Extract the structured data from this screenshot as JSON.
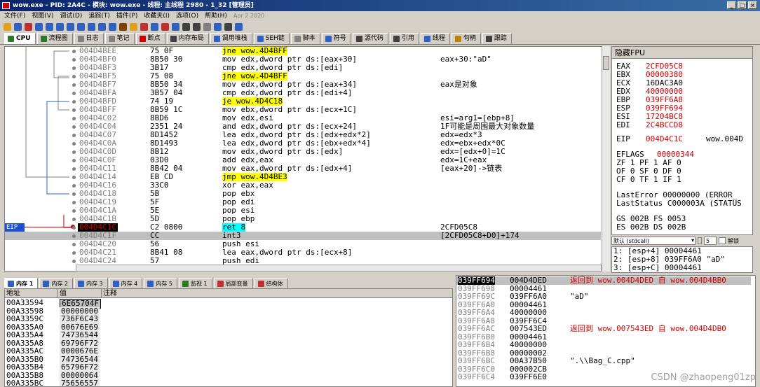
{
  "window": {
    "title": "wow.exe - PID: 2A4C - 模块: wow.exe - 线程: 主线程 2980 - 1_32 [管理员]"
  },
  "menu": {
    "items": [
      "文件(F)",
      "视图(V)",
      "调试(D)",
      "追踪(T)",
      "插件(P)",
      "收藏夹(I)",
      "选项(O)",
      "帮助(H)"
    ],
    "date": "Apr 2 2020"
  },
  "tabs": [
    {
      "label": "CPU",
      "color": "#2a7a2a"
    },
    {
      "label": "流程图",
      "color": "#2a7a2a"
    },
    {
      "label": "日志",
      "color": "#808080"
    },
    {
      "label": "笔记",
      "color": "#808080"
    },
    {
      "label": "断点",
      "color": "#cc0000"
    },
    {
      "label": "内存布局",
      "color": "#404040"
    },
    {
      "label": "调用堆栈",
      "color": "#3060c0"
    },
    {
      "label": "SEH链",
      "color": "#3060c0"
    },
    {
      "label": "脚本",
      "color": "#808080"
    },
    {
      "label": "符号",
      "color": "#3060c0"
    },
    {
      "label": "源代码",
      "color": "#404040"
    },
    {
      "label": "引用",
      "color": "#404040"
    },
    {
      "label": "线程",
      "color": "#3060c0"
    },
    {
      "label": "句柄",
      "color": "#c08000"
    },
    {
      "label": "跟踪",
      "color": "#404040"
    }
  ],
  "disasm": [
    {
      "addr": "004D4BEE",
      "bytes": "75 0F",
      "instr": "jne wow.4D4BFF",
      "cmt": "",
      "jmp": true
    },
    {
      "addr": "004D4BF0",
      "bytes": "8B50 30",
      "instr": "mov edx,dword ptr ds:[eax+30]",
      "cmt": "eax+30:\"aD\""
    },
    {
      "addr": "004D4BF3",
      "bytes": "3B17",
      "instr": "cmp edx,dword ptr ds:[edi]",
      "cmt": ""
    },
    {
      "addr": "004D4BF5",
      "bytes": "75 08",
      "instr": "jne wow.4D4BFF",
      "cmt": "",
      "jmp": true
    },
    {
      "addr": "004D4BF7",
      "bytes": "8B50 34",
      "instr": "mov edx,dword ptr ds:[eax+34]",
      "cmt": "eax是对象"
    },
    {
      "addr": "004D4BFA",
      "bytes": "3B57 04",
      "instr": "cmp edx,dword ptr ds:[edi+4]",
      "cmt": ""
    },
    {
      "addr": "004D4BFD",
      "bytes": "74 19",
      "instr": "je wow.4D4C18",
      "cmt": "",
      "jmp": true
    },
    {
      "addr": "004D4BFF",
      "bytes": "8B59 1C",
      "instr": "mov ebx,dword ptr ds:[ecx+1C]",
      "cmt": ""
    },
    {
      "addr": "004D4C02",
      "bytes": "8BD6",
      "instr": "mov edx,esi",
      "cmt": "esi=arg1=[ebp+8]"
    },
    {
      "addr": "004D4C04",
      "bytes": "2351 24",
      "instr": "and edx,dword ptr ds:[ecx+24]",
      "cmt": "1F可能是周围最大对象数量"
    },
    {
      "addr": "004D4C07",
      "bytes": "8D1452",
      "instr": "lea edx,dword ptr ds:[edx+edx*2]",
      "cmt": "edx=edx*3"
    },
    {
      "addr": "004D4C0A",
      "bytes": "8D1493",
      "instr": "lea edx,dword ptr ds:[ebx+edx*4]",
      "cmt": "edx=ebx+edx*0C"
    },
    {
      "addr": "004D4C0D",
      "bytes": "8B12",
      "instr": "mov edx,dword ptr ds:[edx]",
      "cmt": "edx=[edx+0]=1C"
    },
    {
      "addr": "004D4C0F",
      "bytes": "03D0",
      "instr": "add edx,eax",
      "cmt": "edx=1C+eax"
    },
    {
      "addr": "004D4C11",
      "bytes": "8B42 04",
      "instr": "mov eax,dword ptr ds:[edx+4]",
      "cmt": "[eax+20]->链表"
    },
    {
      "addr": "004D4C14",
      "bytes": "EB CD",
      "instr": "jmp wow.4D4BE3",
      "cmt": "",
      "jmp": true
    },
    {
      "addr": "004D4C16",
      "bytes": "33C0",
      "instr": "xor eax,eax",
      "cmt": ""
    },
    {
      "addr": "004D4C18",
      "bytes": "5B",
      "instr": "pop ebx",
      "cmt": ""
    },
    {
      "addr": "004D4C19",
      "bytes": "5F",
      "instr": "pop edi",
      "cmt": ""
    },
    {
      "addr": "004D4C1A",
      "bytes": "5E",
      "instr": "pop esi",
      "cmt": ""
    },
    {
      "addr": "004D4C1B",
      "bytes": "5D",
      "instr": "pop ebp",
      "cmt": ""
    },
    {
      "addr": "004D4C1C",
      "bytes": "C2 0800",
      "instr": "ret 8",
      "cmt": "2CFD05C8",
      "cur": true
    },
    {
      "addr": "004D4C1F",
      "bytes": "CC",
      "instr": "int3",
      "cmt": "[2CFD05C8+D0]+174",
      "sel": true
    },
    {
      "addr": "004D4C20",
      "bytes": "56",
      "instr": "push esi",
      "cmt": ""
    },
    {
      "addr": "004D4C21",
      "bytes": "8B41 08",
      "instr": "lea eax,dword ptr ds:[ecx+8]",
      "cmt": ""
    },
    {
      "addr": "004D4C24",
      "bytes": "57",
      "instr": "push edi",
      "cmt": ""
    }
  ],
  "eip_label": "EIP",
  "regs": {
    "header": "隐藏FPU",
    "lines": [
      {
        "name": "EAX",
        "val": "2CFD05C8",
        "red": true
      },
      {
        "name": "EBX",
        "val": "00000380",
        "red": true
      },
      {
        "name": "ECX",
        "val": "16DAC3A0",
        "red": false
      },
      {
        "name": "EDX",
        "val": "40000000",
        "red": true
      },
      {
        "name": "EBP",
        "val": "039FF6A8",
        "red": true
      },
      {
        "name": "ESP",
        "val": "039FF694",
        "red": true
      },
      {
        "name": "ESI",
        "val": "17204BC8",
        "red": true
      },
      {
        "name": "EDI",
        "val": "2C4BCCD8",
        "red": true
      }
    ],
    "eip": {
      "name": "EIP",
      "val": "004D4C1C",
      "sym": "wow.004D"
    },
    "eflags": {
      "name": "EFLAGS",
      "val": "00000344"
    },
    "flags1": "ZF 1  PF 1  AF 0",
    "flags2": "OF 0  SF 0  DF 0",
    "flags3": "CF 0  TF 1  IF 1",
    "lasterror": "LastError  00000000 (ERROR_",
    "laststatus": "LastStatus C000003A (STATUS",
    "seg1": "GS 002B  FS 0053",
    "seg2": "ES 002B  DS 002B"
  },
  "stack_cfg": {
    "convention": "默认 (stdcall)",
    "count": "5",
    "unlock": "解锁"
  },
  "stack_args": [
    "1: [esp+4] 00004461",
    "2: [esp+8] 039FF6A0 \"aD\"",
    "3: [esp+C] 00004461"
  ],
  "dump_tabs": [
    "内存 1",
    "内存 2",
    "内存 3",
    "内存 4",
    "内存 5",
    "监视 1",
    "局部变量",
    "结构体"
  ],
  "dump_head": {
    "addr": "地址",
    "value": "值",
    "comment": "注释"
  },
  "dump": [
    {
      "a": "00A33594",
      "v": "6E65704F"
    },
    {
      "a": "00A33598",
      "v": "00000000"
    },
    {
      "a": "00A3359C",
      "v": "736F6C43"
    },
    {
      "a": "00A335A0",
      "v": "00676E69"
    },
    {
      "a": "00A335A4",
      "v": "74736544"
    },
    {
      "a": "00A335A8",
      "v": "69796F72"
    },
    {
      "a": "00A335AC",
      "v": "0000676E"
    },
    {
      "a": "00A335B0",
      "v": "74736544"
    },
    {
      "a": "00A335B4",
      "v": "65796F72"
    },
    {
      "a": "00A335B8",
      "v": "00000064"
    },
    {
      "a": "00A335BC",
      "v": "75656557"
    }
  ],
  "stack": [
    {
      "a": "039FF694",
      "v": "004D4DED",
      "c": "返回到 wow.004D4DED 自 wow.004D4BB0",
      "red": true
    },
    {
      "a": "039FF698",
      "v": "00004461",
      "c": ""
    },
    {
      "a": "039FF69C",
      "v": "039FF6A0",
      "c": "\"aD\""
    },
    {
      "a": "039FF6A0",
      "v": "00004461",
      "c": ""
    },
    {
      "a": "039FF6A4",
      "v": "40000000",
      "c": ""
    },
    {
      "a": "039FF6A8",
      "v": "039FF6C4",
      "c": ""
    },
    {
      "a": "039FF6AC",
      "v": "007543ED",
      "c": "返回到 wow.007543ED 自 wow.004D4DB0",
      "red": true
    },
    {
      "a": "039FF6B0",
      "v": "00004461",
      "c": ""
    },
    {
      "a": "039FF6B4",
      "v": "40000000",
      "c": ""
    },
    {
      "a": "039FF6B8",
      "v": "00000002",
      "c": ""
    },
    {
      "a": "039FF6BC",
      "v": "00A37B50",
      "c": "\".\\\\Bag_C.cpp\""
    },
    {
      "a": "039FF6C0",
      "v": "000002CB",
      "c": ""
    },
    {
      "a": "039FF6C4",
      "v": "039FF6E0",
      "c": ""
    }
  ],
  "watermark": "CSDN @zhaopeng01zp"
}
